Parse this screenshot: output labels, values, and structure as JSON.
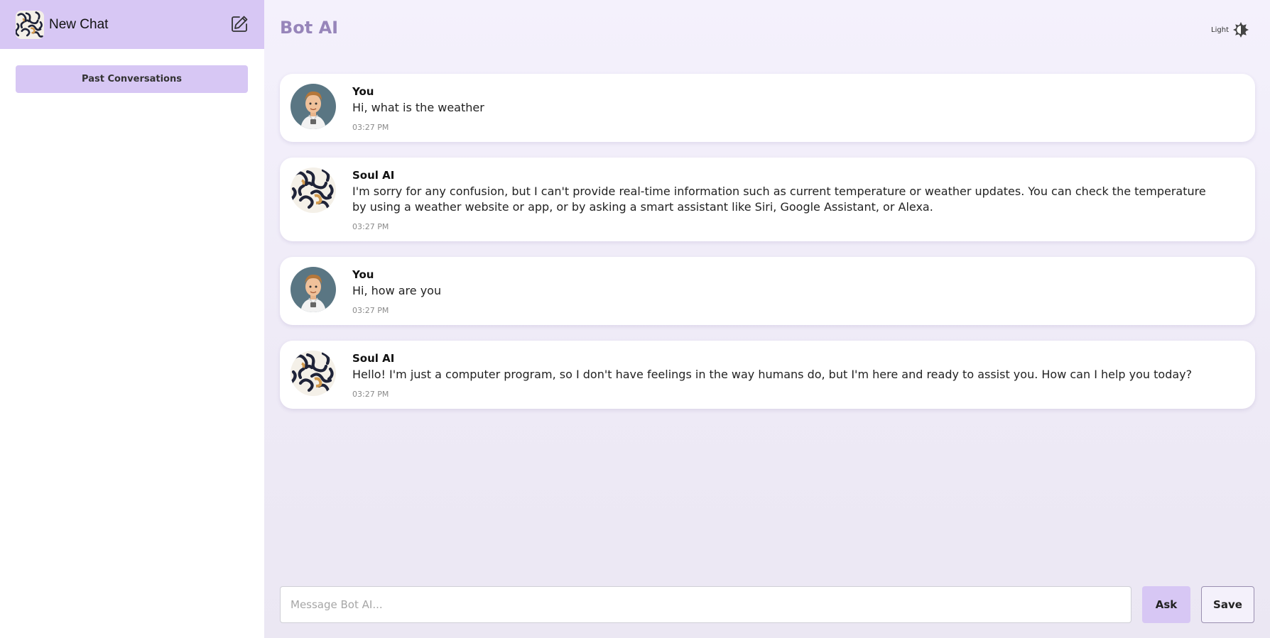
{
  "sidebar": {
    "title": "New Chat",
    "past_conversations_label": "Past Conversations",
    "logo_icon": "swirl-pattern-logo",
    "edit_icon": "edit-icon"
  },
  "header": {
    "title": "Bot AI",
    "theme_label": "Light",
    "theme_icon": "theme-toggle-icon"
  },
  "messages": [
    {
      "author": "You",
      "text": "Hi, what is the weather",
      "time": "03:27 PM",
      "avatar": "user-avatar"
    },
    {
      "author": "Soul AI",
      "text": "I'm sorry for any confusion, but I can't provide real-time information such as current temperature or weather updates. You can check the temperature by using a weather website or app, or by asking a smart assistant like Siri, Google Assistant, or Alexa.",
      "time": "03:27 PM",
      "avatar": "bot-avatar"
    },
    {
      "author": "You",
      "text": "Hi, how are you",
      "time": "03:27 PM",
      "avatar": "user-avatar"
    },
    {
      "author": "Soul AI",
      "text": "Hello! I'm just a computer program, so I don't have feelings in the way humans do, but I'm here and ready to assist you. How can I help you today?",
      "time": "03:27 PM",
      "avatar": "bot-avatar"
    }
  ],
  "composer": {
    "placeholder": "Message Bot AI...",
    "value": "",
    "ask_label": "Ask",
    "save_label": "Save"
  },
  "colors": {
    "accent": "#d7c7f4",
    "title": "#9785ba",
    "background": "#f4f1fc"
  }
}
